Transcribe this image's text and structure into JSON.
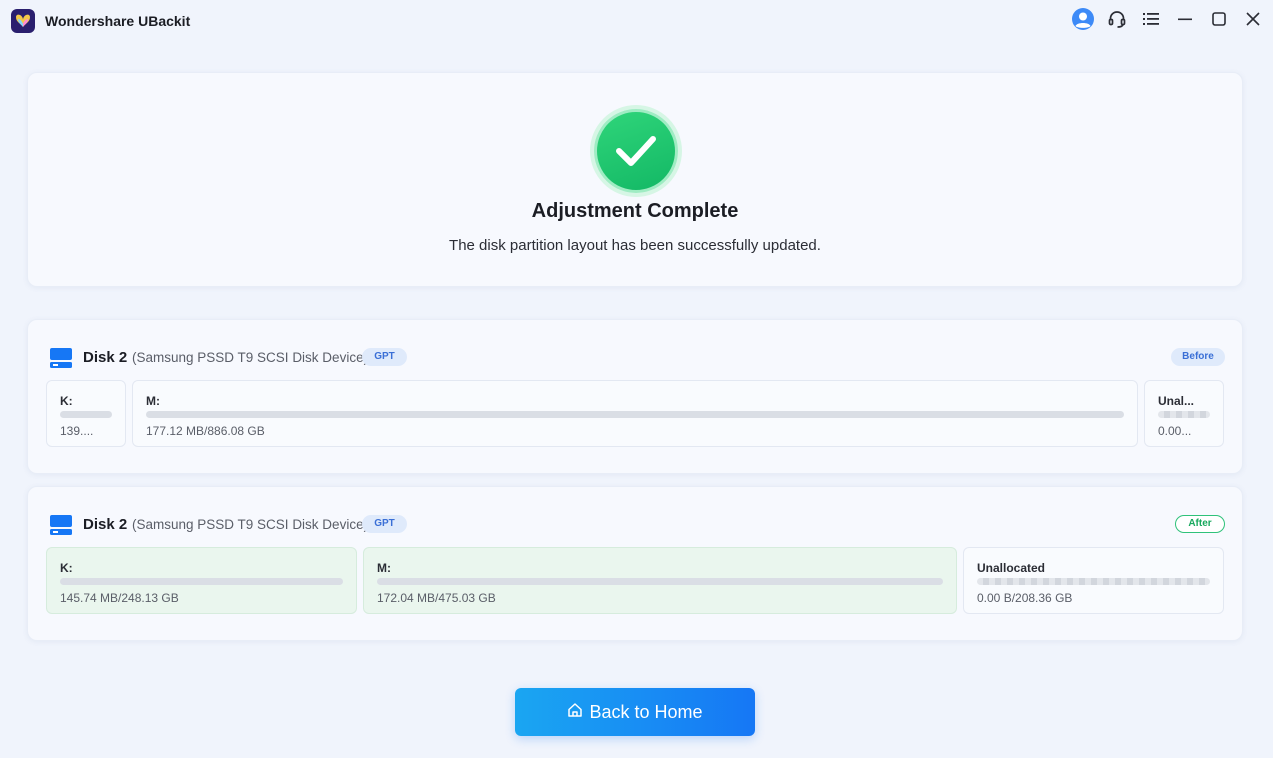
{
  "app": {
    "title": "Wondershare UBackit"
  },
  "window_controls": [
    "user-icon",
    "headset-icon",
    "menu-icon",
    "minimize-icon",
    "maximize-icon",
    "close-icon"
  ],
  "result": {
    "title": "Adjustment Complete",
    "description": "The disk partition layout has been successfully updated."
  },
  "before": {
    "disk_name": "Disk 2",
    "disk_model": "(Samsung PSSD T9 SCSI Disk Device)",
    "partition_style": "GPT",
    "state": "Before",
    "partitions": [
      {
        "label": "K:",
        "size": "139....",
        "used_fraction": 0
      },
      {
        "label": "M:",
        "size": "177.12 MB/886.08 GB",
        "used_fraction": 0
      },
      {
        "label": "Unal...",
        "size": "0.00...",
        "used_fraction": 0
      }
    ]
  },
  "after": {
    "disk_name": "Disk 2",
    "disk_model": "(Samsung PSSD T9 SCSI Disk Device)",
    "partition_style": "GPT",
    "state": "After",
    "partitions": [
      {
        "label": "K:",
        "size": "145.74 MB/248.13 GB",
        "used_fraction": 0
      },
      {
        "label": "M:",
        "size": "172.04 MB/475.03 GB",
        "used_fraction": 0
      },
      {
        "label": "Unallocated",
        "size": "0.00 B/208.36 GB",
        "used_fraction": 0
      }
    ]
  },
  "actions": {
    "back_home_label": "Back to Home"
  },
  "colors": {
    "accent": "#1677f5",
    "success": "#13b865"
  }
}
